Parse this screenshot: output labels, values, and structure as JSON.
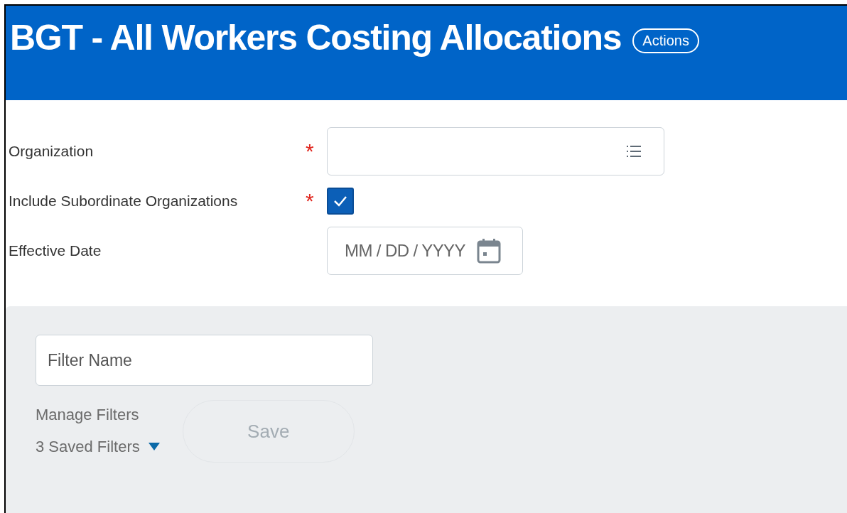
{
  "header": {
    "title": "BGT - All Workers Costing Allocations",
    "actions_button": "Actions"
  },
  "fields": [
    {
      "kind": "prompt",
      "label": "Organization",
      "required_mark": "*"
    },
    {
      "kind": "checkbox",
      "label": "Include Subordinate Organizations",
      "required_mark": "*",
      "checked": true
    },
    {
      "kind": "date",
      "label": "Effective Date",
      "placeholder": "MM / DD / YYYY"
    }
  ],
  "filter_panel": {
    "filter_name": {
      "placeholder": "Filter Name"
    },
    "manage_filters": "Manage Filters",
    "saved_filters": "3 Saved Filters",
    "save_button": {
      "label": "Save",
      "disabled": true
    }
  }
}
